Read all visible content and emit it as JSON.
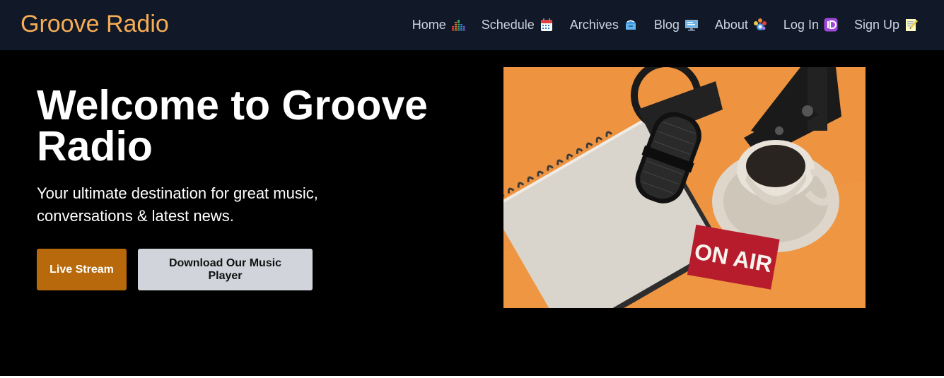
{
  "header": {
    "brand": "Groove Radio",
    "nav": [
      {
        "label": "Home",
        "icon": "equalizer-icon"
      },
      {
        "label": "Schedule",
        "icon": "calendar-icon"
      },
      {
        "label": "Archives",
        "icon": "file-box-icon"
      },
      {
        "label": "Blog",
        "icon": "monitor-icon"
      },
      {
        "label": "About",
        "icon": "people-icon"
      },
      {
        "label": "Log In",
        "icon": "id-icon"
      },
      {
        "label": "Sign Up",
        "icon": "memo-icon"
      }
    ]
  },
  "hero": {
    "title": "Welcome to Groove Radio",
    "subtitle": "Your ultimate destination for great music, conversations & latest news.",
    "primary_button": "Live Stream",
    "secondary_button": "Download Our Music Player",
    "image_sign_text": "ON AIR"
  },
  "colors": {
    "nav_bg": "#111827",
    "brand": "#f6ad55",
    "nav_text": "#cbd5e0",
    "hero_bg": "#000000",
    "primary_button": "#b7690b",
    "secondary_button": "#d1d5db"
  }
}
